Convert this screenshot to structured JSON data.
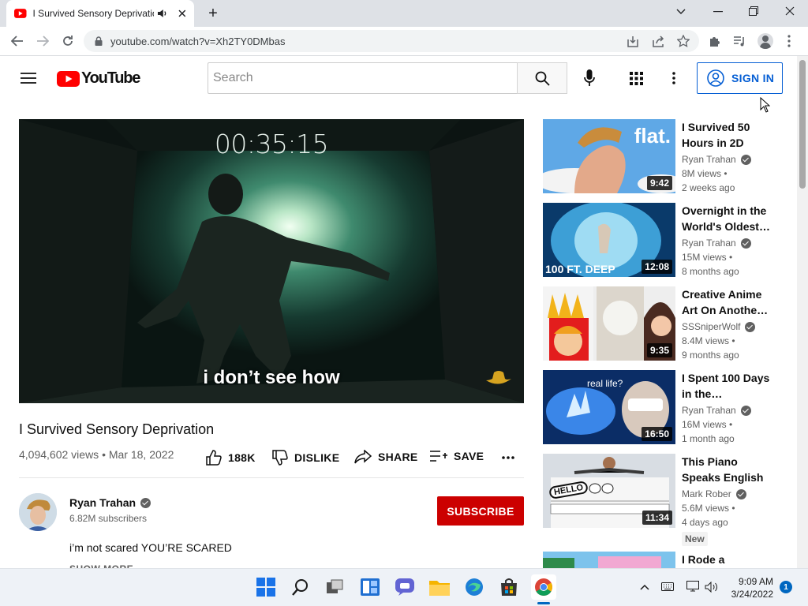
{
  "browser": {
    "tab_title": "I Survived Sensory Deprivatio",
    "url": "youtube.com/watch?v=Xh2TY0DMbas",
    "new_tab_symbol": "+"
  },
  "youtube": {
    "logo_text": "YouTube",
    "search_placeholder": "Search",
    "sign_in_label": "SIGN IN"
  },
  "player": {
    "timer_overlay": "00:35:15",
    "caption": "i don’t see how"
  },
  "video": {
    "title": "I Survived Sensory Deprivation",
    "views_date": "4,094,602 views • Mar 18, 2022",
    "likes": "188K",
    "dislike_label": "DISLIKE",
    "share_label": "SHARE",
    "save_label": "SAVE"
  },
  "channel": {
    "name": "Ryan Trahan",
    "subscribers": "6.82M subscribers",
    "subscribe_label": "SUBSCRIBE",
    "description": "i’m not scared YOU’RE SCARED",
    "show_more": "SHOW MORE"
  },
  "recommendations": [
    {
      "title": "I Survived 50 Hours in 2D",
      "channel": "Ryan Trahan",
      "views": "8M views •",
      "age": "2 weeks ago",
      "duration": "9:42",
      "thumb_text": "flat."
    },
    {
      "title": "Overnight in the World's Oldest…",
      "channel": "Ryan Trahan",
      "views": "15M views •",
      "age": "8 months ago",
      "duration": "12:08",
      "thumb_text": "100 FT. DEEP"
    },
    {
      "title": "Creative Anime Art On Anothe…",
      "channel": "SSSniperWolf",
      "views": "8.4M views •",
      "age": "9 months ago",
      "duration": "9:35",
      "thumb_text": ""
    },
    {
      "title": "I Spent 100 Days in the…",
      "channel": "Ryan Trahan",
      "views": "16M views •",
      "age": "1 month ago",
      "duration": "16:50",
      "thumb_text": "real life?"
    },
    {
      "title": "This Piano Speaks English",
      "channel": "Mark Rober",
      "views": "5.6M views •",
      "age": "4 days ago",
      "duration": "11:34",
      "thumb_text": "HELLO"
    },
    {
      "title": "I Rode a",
      "channel": "",
      "views": "",
      "age": "",
      "duration": "",
      "thumb_text": ""
    }
  ],
  "new_badge": "New",
  "taskbar": {
    "time": "9:09 AM",
    "date": "3/24/2022",
    "notification_count": "1"
  }
}
